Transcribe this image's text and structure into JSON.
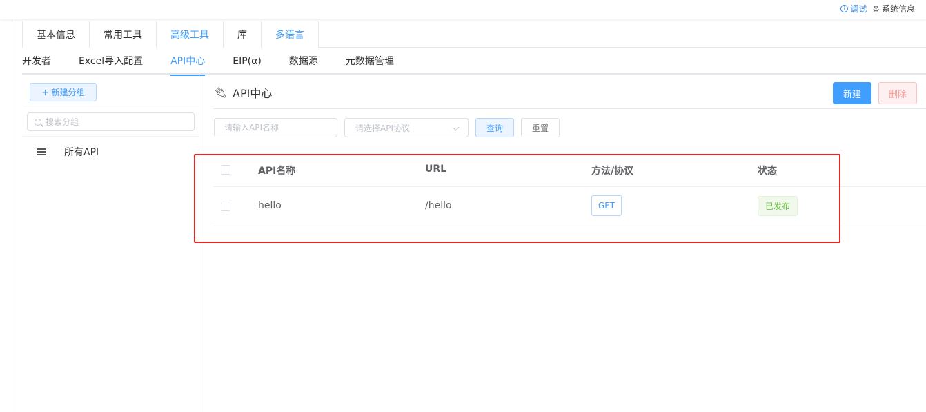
{
  "topbar": {
    "debug_label": "调试",
    "sysinfo_label": "系统信息"
  },
  "main_tabs": [
    "基本信息",
    "常用工具",
    "高级工具",
    "库",
    "多语言"
  ],
  "sub_tabs": [
    "开发者",
    "Excel导入配置",
    "API中心",
    "EIP(α)",
    "数据源",
    "元数据管理"
  ],
  "sidebar": {
    "new_group_label": "新建分组",
    "search_placeholder": "搜索分组",
    "all_api_label": "所有API"
  },
  "panel": {
    "title": "API中心",
    "new_label": "新建",
    "delete_label": "删除",
    "name_placeholder": "请输入API名称",
    "protocol_placeholder": "请选择API协议",
    "query_label": "查询",
    "reset_label": "重置"
  },
  "table": {
    "headers": {
      "name": "API名称",
      "url": "URL",
      "method": "方法/协议",
      "status": "状态"
    },
    "rows": [
      {
        "name": "hello",
        "url": "/hello",
        "method": "GET",
        "status": "已发布"
      }
    ]
  },
  "colors": {
    "accent": "#409eff",
    "success": "#67c23a",
    "danger": "#f56c6c",
    "highlight": "#e62727"
  }
}
